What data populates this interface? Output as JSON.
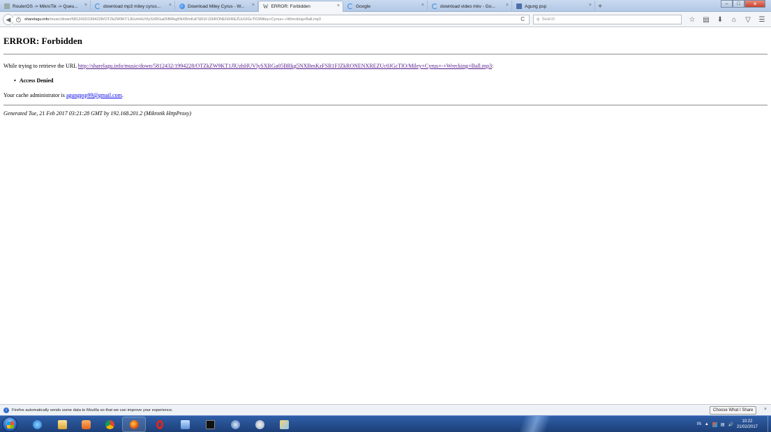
{
  "browser": {
    "tabs": [
      {
        "label": "RouterOS -> MikroTik -> Queu...",
        "icon": "generic-icon"
      },
      {
        "label": "download mp3 miley cyrus...",
        "icon": "loading-icon"
      },
      {
        "label": "Download Miley Cyrus - W...",
        "icon": "globe-icon"
      },
      {
        "label": "ERROR: Forbidden",
        "icon": "w-icon",
        "active": true
      },
      {
        "label": "Google",
        "icon": "loading-icon"
      },
      {
        "label": "download video mkv - Go...",
        "icon": "loading-icon"
      },
      {
        "label": "Agung psp",
        "icon": "tile-icon"
      }
    ],
    "new_tab": "+",
    "tab_close": "×",
    "window_controls": {
      "minimize": "–",
      "maximize": "□",
      "close": "✕"
    },
    "address": {
      "domain": "sharelagu.info",
      "path": "/music/down/5812432/1994228/OTZkZW9KT1JlUzhHUVlySXRGa05BRkg5NXBmKzFSR1FJZkRONENXREZUc0JGcTlO/Miley+Cyrus+-+Wrecking+Ball.mp3"
    },
    "reload": "C",
    "search_placeholder": "Search",
    "toolbar_icons": [
      "star-icon",
      "reading-list-icon",
      "download-icon",
      "home-icon",
      "pocket-icon",
      "menu-icon"
    ]
  },
  "page": {
    "title": "ERROR: Forbidden",
    "retrieve_prefix": "While trying to retrieve the URL ",
    "url": "http://sharelagu.info/music/down/5812432/1994228/OTZkZW9KT1JlUzhHUVlySXRGa05BRkg5NXBmKzFSR1FJZkRONENXREZUc0JGcTlO/Miley+Cyrus+-+Wrecking+Ball.mp3",
    "url_suffix": ":",
    "reason": "Access Denied",
    "admin_prefix": "Your cache administrator is ",
    "admin_email": "agungpsp99@gmail.com",
    "admin_suffix": ".",
    "generated": "Generated Tue, 21 Feb 2017 03:21:28 GMT by 192.168.201.2 (Mikrotik HttpProxy)"
  },
  "notification": {
    "message": "Firefox automatically sends some data to Mozilla so that we can improve your experience.",
    "button": "Choose What I Share",
    "close": "×"
  },
  "taskbar": {
    "apps": [
      "ie-icon",
      "explorer-icon",
      "media-player-icon",
      "chrome-icon",
      "firefox-icon",
      "opera-icon",
      "network-icon",
      "cmd-icon",
      "app-icon",
      "search-app-icon",
      "paint-icon"
    ],
    "language": "IN",
    "time": "10:22",
    "date": "21/02/2017"
  }
}
